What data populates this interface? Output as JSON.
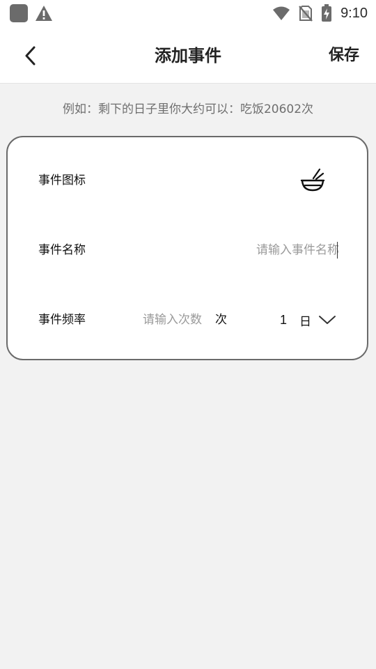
{
  "status_bar": {
    "time": "9:10",
    "icons": [
      "app-icon",
      "warning-icon",
      "wifi-icon",
      "no-sim-icon",
      "battery-charging-icon"
    ]
  },
  "header": {
    "title": "添加事件",
    "save_label": "保存",
    "back_icon": "chevron-left-icon"
  },
  "hint": "例如：剩下的日子里你大约可以：吃饭20602次",
  "form": {
    "icon_row": {
      "label": "事件图标",
      "icon": "bowl-chopsticks-icon"
    },
    "name_row": {
      "label": "事件名称",
      "placeholder": "请输入事件名称",
      "value": ""
    },
    "frequency_row": {
      "label": "事件频率",
      "count_placeholder": "请输入次数",
      "count_value": "",
      "count_unit": "次",
      "period_number": "1",
      "period_unit": "日",
      "dropdown_icon": "chevron-down-icon"
    }
  },
  "colors": {
    "background": "#f2f2f2",
    "card_border": "#6a6a6a",
    "placeholder": "#9a9a9a",
    "hint_text": "#6f6f6f"
  }
}
